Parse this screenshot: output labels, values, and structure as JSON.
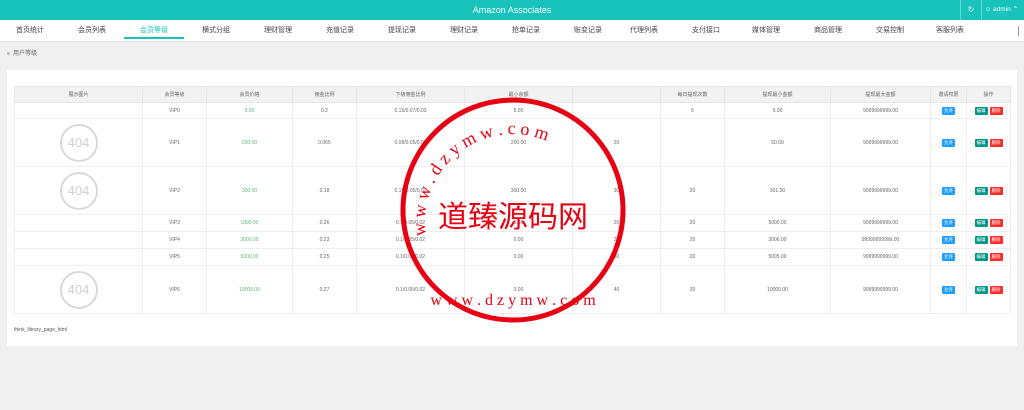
{
  "header": {
    "title": "Amazon Associates",
    "refresh_icon": "refresh-icon",
    "user_name": "admin"
  },
  "nav": {
    "tabs": [
      {
        "label": "首页统计",
        "active": false
      },
      {
        "label": "会员列表",
        "active": false
      },
      {
        "label": "会员等级",
        "active": true
      },
      {
        "label": "横式分组",
        "active": false
      },
      {
        "label": "理财管理",
        "active": false
      },
      {
        "label": "充值记录",
        "active": false
      },
      {
        "label": "提现记录",
        "active": false
      },
      {
        "label": "理财记录",
        "active": false
      },
      {
        "label": "抢单记录",
        "active": false
      },
      {
        "label": "账变记录",
        "active": false
      },
      {
        "label": "代理列表",
        "active": false
      },
      {
        "label": "支付接口",
        "active": false
      },
      {
        "label": "媒体管理",
        "active": false
      },
      {
        "label": "商品管理",
        "active": false
      },
      {
        "label": "交易控制",
        "active": false
      },
      {
        "label": "客服列表",
        "active": false
      }
    ]
  },
  "breadcrumb": "用户等级",
  "table": {
    "columns": [
      "展示图片",
      "会员等级",
      "会员价格",
      "佣金比例",
      "下级佣金比例",
      "最小余额",
      "",
      "每日提现次数",
      "提现最小金额",
      "提现最大金额",
      "邀请权限",
      "操作"
    ],
    "rows": [
      {
        "image": "",
        "level": "VIP0",
        "price": "5.00",
        "commission": "0.2",
        "sub": "0.15/0.07/0.03",
        "min_balance": "5.00",
        "col7": "",
        "daily": "5",
        "wmin": "5.00",
        "wmax": "9999999999.00"
      },
      {
        "image": "404",
        "level": "VIP1",
        "price": "200.00",
        "commission": "0.065",
        "sub": "0.08/0.05/0.02",
        "min_balance": "200.00",
        "col7": "20",
        "daily": "",
        "wmin": "50.00",
        "wmax": "9999999999.00"
      },
      {
        "image": "404",
        "level": "VIP2",
        "price": "300.00",
        "commission": "0.18",
        "sub": "0.15/0.05/0.02",
        "min_balance": "300.00",
        "col7": "30",
        "daily": "20",
        "wmin": "301.00",
        "wmax": "9999999999.00"
      },
      {
        "image": "",
        "level": "VIP3",
        "price": "1000.00",
        "commission": "0.26",
        "sub": "0.1/0.05/0.02",
        "min_balance": "0.00",
        "col7": "20",
        "daily": "20",
        "wmin": "5000.00",
        "wmax": "9999999999.00"
      },
      {
        "image": "",
        "level": "VIP4",
        "price": "3000.00",
        "commission": "0.23",
        "sub": "0.1/0.05/0.02",
        "min_balance": "0.00",
        "col7": "20",
        "daily": "20",
        "wmin": "3006.00",
        "wmax": "99999999999.00"
      },
      {
        "image": "",
        "level": "VIP5",
        "price": "5000.00",
        "commission": "0.25",
        "sub": "0.1/0.05/0.02",
        "min_balance": "0.00",
        "col7": "30",
        "daily": "20",
        "wmin": "5005.00",
        "wmax": "9999999999.00"
      },
      {
        "image": "404",
        "level": "VIP6",
        "price": "10000.00",
        "commission": "0.27",
        "sub": "0.1/0.05/0.02",
        "min_balance": "0.00",
        "col7": "40",
        "daily": "20",
        "wmin": "10000.00",
        "wmax": "9999999999.00"
      }
    ],
    "invite_label": "允许",
    "edit_label": "编辑",
    "delete_label": "删除"
  },
  "page_html": "think_library_page_html",
  "watermark": {
    "center": "道臻源码网",
    "ring": "w w w . d z y m w . c o m",
    "color": "#e60012"
  }
}
